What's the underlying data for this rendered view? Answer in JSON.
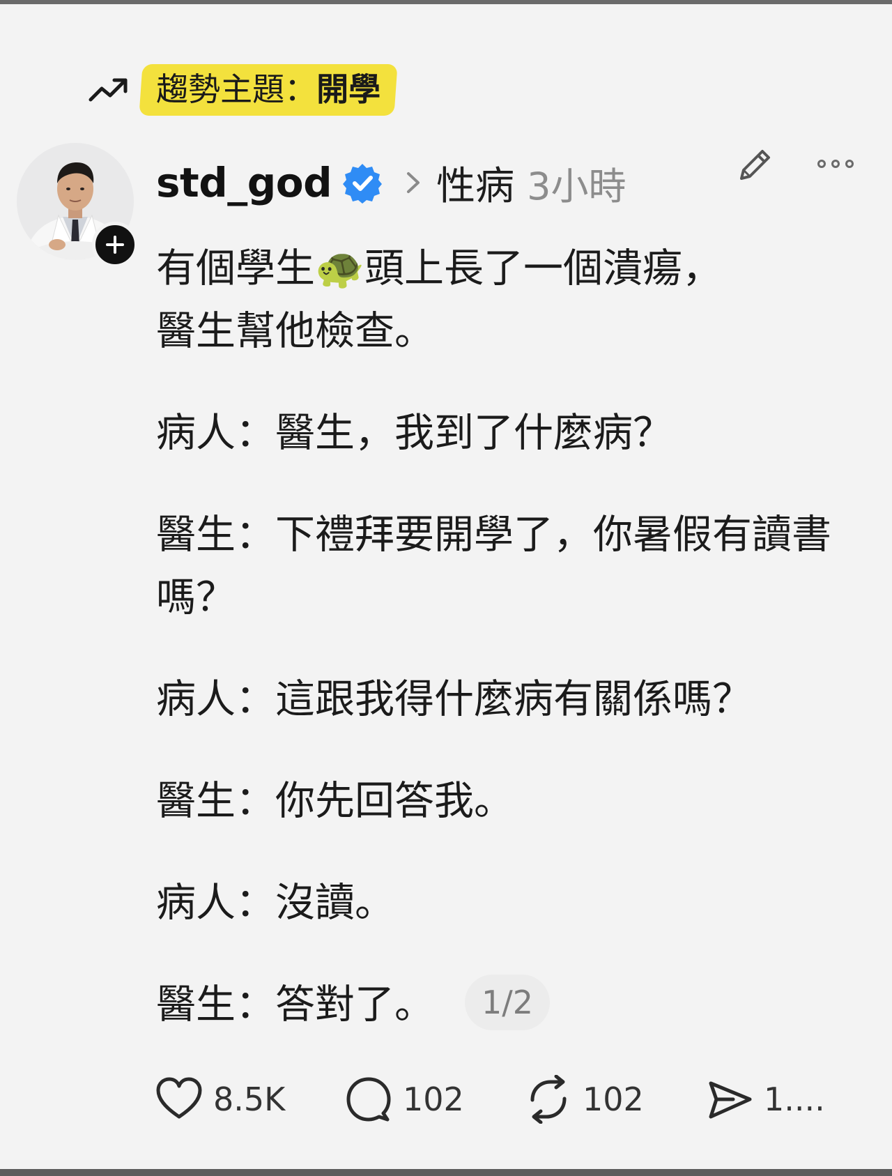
{
  "trend": {
    "prefix": "趨勢主題：",
    "topic": "開學",
    "icon": "trending-up-icon",
    "chip_color": "#f3e13d"
  },
  "post": {
    "username": "std_god",
    "verified": true,
    "verified_color": "#2f8cf5",
    "community": "性病",
    "time": "3小時",
    "paragraphs": [
      "有個學生🐢頭上長了一個潰瘍，\n醫生幫他檢查。",
      "病人：醫生，我到了什麼病？",
      "醫生：下禮拜要開學了，你暑假有讀書嗎？",
      "病人：這跟我得什麼病有關係嗎？",
      "醫生：你先回答我。",
      "病人：沒讀。",
      "醫生：答對了。"
    ],
    "page_indicator": "1/2"
  },
  "actions": {
    "like_count": "8.5K",
    "reply_count": "102",
    "repost_count": "102",
    "share_count": "1...."
  }
}
